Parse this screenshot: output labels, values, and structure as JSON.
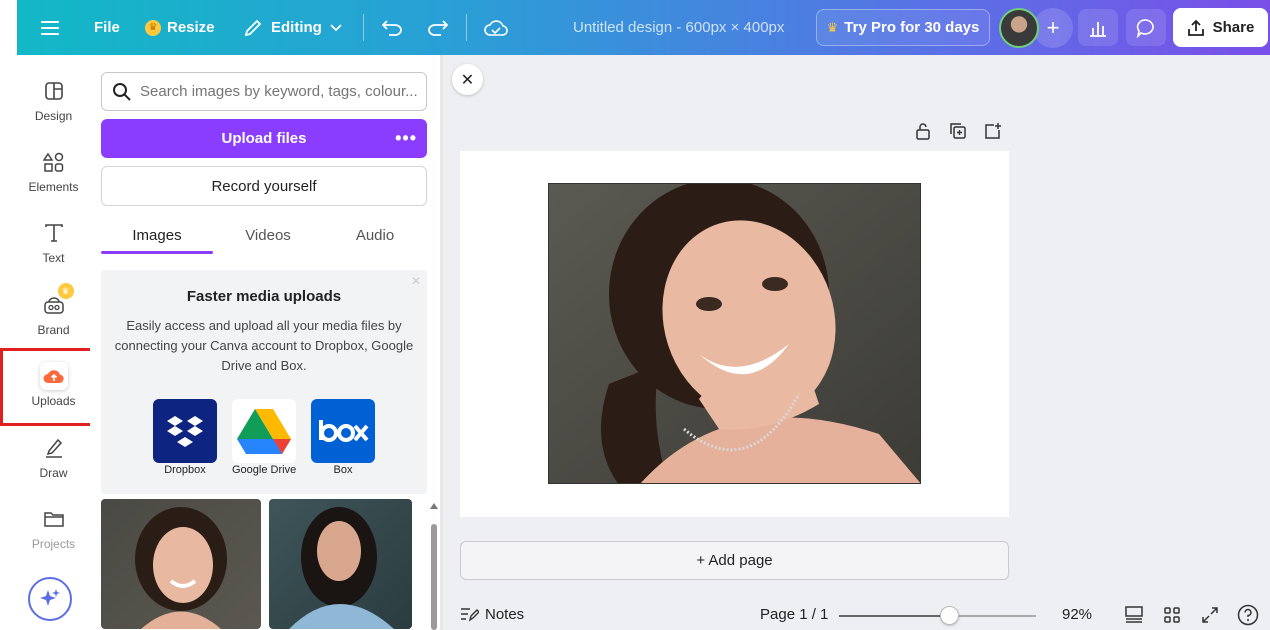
{
  "header": {
    "file_label": "File",
    "resize_label": "Resize",
    "editing_label": "Editing",
    "title": "Untitled design - 600px × 400px",
    "try_pro_label": "Try Pro for 30 days",
    "share_label": "Share"
  },
  "rail": {
    "items": [
      {
        "label": "Design",
        "icon": "layout-icon"
      },
      {
        "label": "Elements",
        "icon": "shapes-icon"
      },
      {
        "label": "Text",
        "icon": "text-icon"
      },
      {
        "label": "Brand",
        "icon": "brand-icon"
      },
      {
        "label": "Uploads",
        "icon": "upload-cloud-icon"
      },
      {
        "label": "Draw",
        "icon": "draw-icon"
      },
      {
        "label": "Projects",
        "icon": "folder-icon"
      }
    ]
  },
  "panel": {
    "search_placeholder": "Search images by keyword, tags, colour...",
    "upload_label": "Upload files",
    "record_label": "Record yourself",
    "tabs": [
      "Images",
      "Videos",
      "Audio"
    ],
    "promo": {
      "title": "Faster media uploads",
      "description": "Easily access and upload all your media files by connecting your Canva account to Dropbox, Google Drive and Box.",
      "services": [
        "Dropbox",
        "Google Drive",
        "Box"
      ]
    }
  },
  "canvas": {
    "add_page_label": "+ Add page"
  },
  "footer": {
    "notes_label": "Notes",
    "page_info": "Page 1 / 1",
    "zoom": "92%",
    "zoom_slider_fraction": 0.56
  },
  "colors": {
    "accent": "#8b3dff",
    "highlight": "#e02020"
  }
}
